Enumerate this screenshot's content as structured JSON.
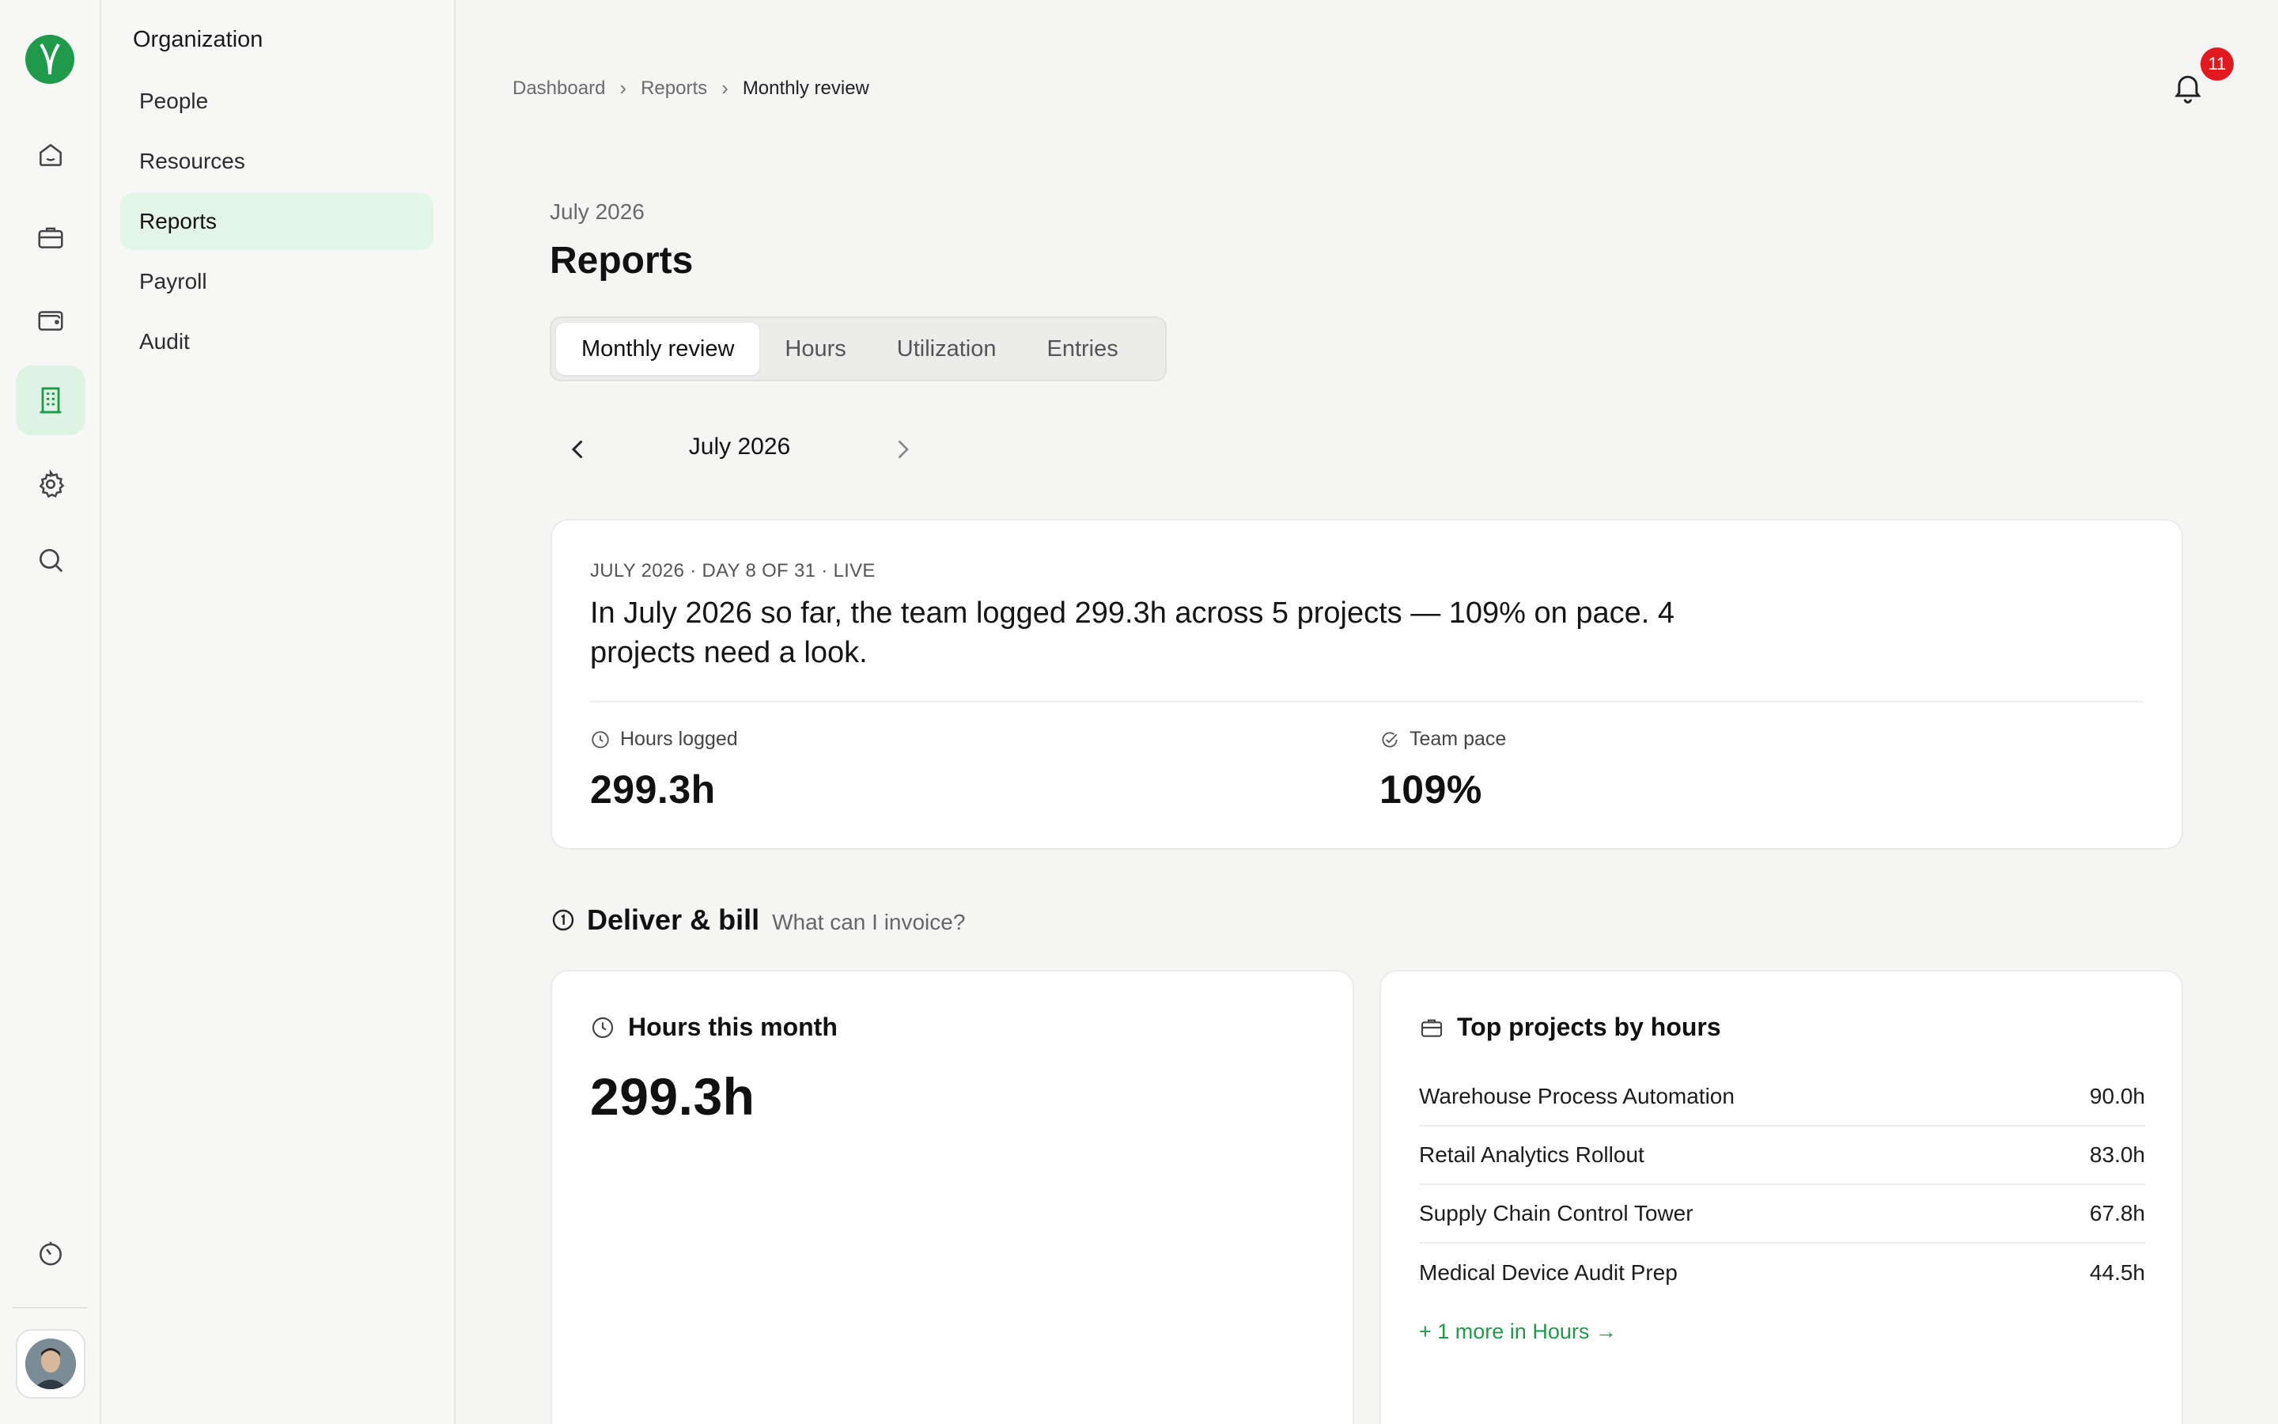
{
  "rail": {
    "logo": "leaf-logo",
    "items": [
      "home-icon",
      "briefcase-icon",
      "wallet-icon",
      "building-icon",
      "gear-icon",
      "search-icon"
    ],
    "active": "building-icon",
    "bottom": [
      "timer-icon"
    ]
  },
  "sidebar": {
    "title": "Organization",
    "items": [
      {
        "label": "People"
      },
      {
        "label": "Resources"
      },
      {
        "label": "Reports"
      },
      {
        "label": "Payroll"
      },
      {
        "label": "Audit"
      }
    ],
    "active": "Reports"
  },
  "breadcrumb": [
    "Dashboard",
    "Reports",
    "Monthly review"
  ],
  "notifications": {
    "count": "11"
  },
  "header": {
    "eyebrow": "July 2026",
    "title": "Reports"
  },
  "tabs": [
    {
      "label": "Monthly review"
    },
    {
      "label": "Hours"
    },
    {
      "label": "Utilization"
    },
    {
      "label": "Entries"
    }
  ],
  "active_tab": "Monthly review",
  "month_picker": {
    "label": "July 2026"
  },
  "summary": {
    "meta": "JULY 2026 · DAY 8 OF 31 · LIVE",
    "headline": "In July 2026 so far, the team logged 299.3h across 5 projects — 109% on pace. 4 projects need a look.",
    "metrics": [
      {
        "label": "Hours logged",
        "value": "299.3h",
        "icon": "clock-icon"
      },
      {
        "label": "Team pace",
        "value": "109%",
        "icon": "gauge-check-icon"
      }
    ]
  },
  "section": {
    "title": "Deliver & bill",
    "subtitle": "What can I invoice?",
    "icon": "number-1-circle-icon"
  },
  "hours_card": {
    "title": "Hours this month",
    "value": "299.3h"
  },
  "top_projects": {
    "title": "Top projects by hours",
    "rows": [
      {
        "name": "Warehouse Process Automation",
        "hours": "90.0h"
      },
      {
        "name": "Retail Analytics Rollout",
        "hours": "83.0h"
      },
      {
        "name": "Supply Chain Control Tower",
        "hours": "67.8h"
      },
      {
        "name": "Medical Device Audit Prep",
        "hours": "44.5h"
      }
    ],
    "more": "+ 1 more in Hours →"
  },
  "colors": {
    "accent": "#1e9a4a",
    "accent_soft": "#e2f5e7",
    "badge": "#e1181d",
    "background": "#f5f5f4"
  }
}
